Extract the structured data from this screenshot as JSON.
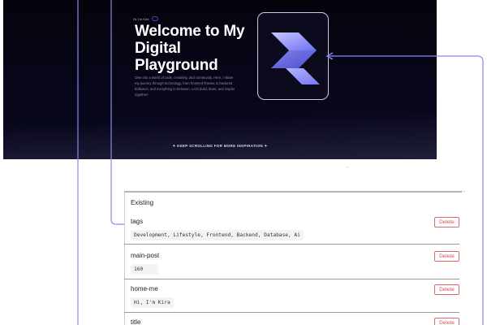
{
  "hero": {
    "intro": "Hi, I'm Kira",
    "badge": "",
    "title": "Welcome to My Digital Playground",
    "subtitle": "Dive into a world of code, creativity, and community. Here, I share my journey through technology, from frontend finesse to backend brilliance, and everything in between. Let's build, learn, and inspire together!",
    "scroll_hint": "✦ KEEP SCROLLING FOR MORE INSPIRATION ✦",
    "logo_icon": "layered-s-logo-icon"
  },
  "colors": {
    "hero_bg": "#05040c",
    "accent": "#9a8cff",
    "connector": "#8a8ae6",
    "delete": "#d9534f"
  },
  "existing": {
    "heading": "Existing",
    "delete_label": "Delete",
    "entries": [
      {
        "key": "tags",
        "value": "Development, Lifestyle, Frontend, Backend, Database, Ai"
      },
      {
        "key": "main-post",
        "value": "160"
      },
      {
        "key": "home-me",
        "value": "Hi, I'm Kira"
      },
      {
        "key": "title",
        "value": ""
      }
    ]
  }
}
